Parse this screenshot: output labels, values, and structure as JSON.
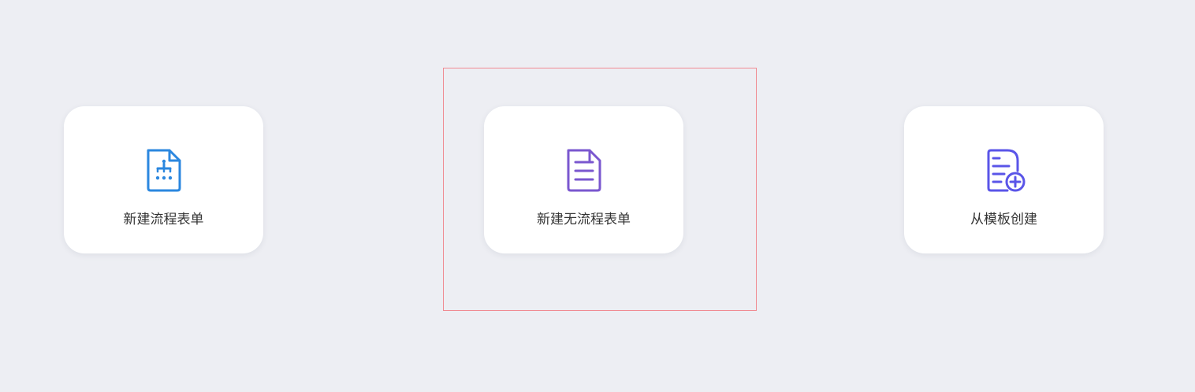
{
  "cards": [
    {
      "label": "新建流程表单",
      "icon": "flow-form-icon",
      "color": "#2b87df"
    },
    {
      "label": "新建无流程表单",
      "icon": "document-lines-icon",
      "color": "#7a57cf"
    },
    {
      "label": "从模板创建",
      "icon": "document-add-icon",
      "color": "#5a55e8"
    }
  ],
  "selection": {
    "color": "#f08b92"
  }
}
